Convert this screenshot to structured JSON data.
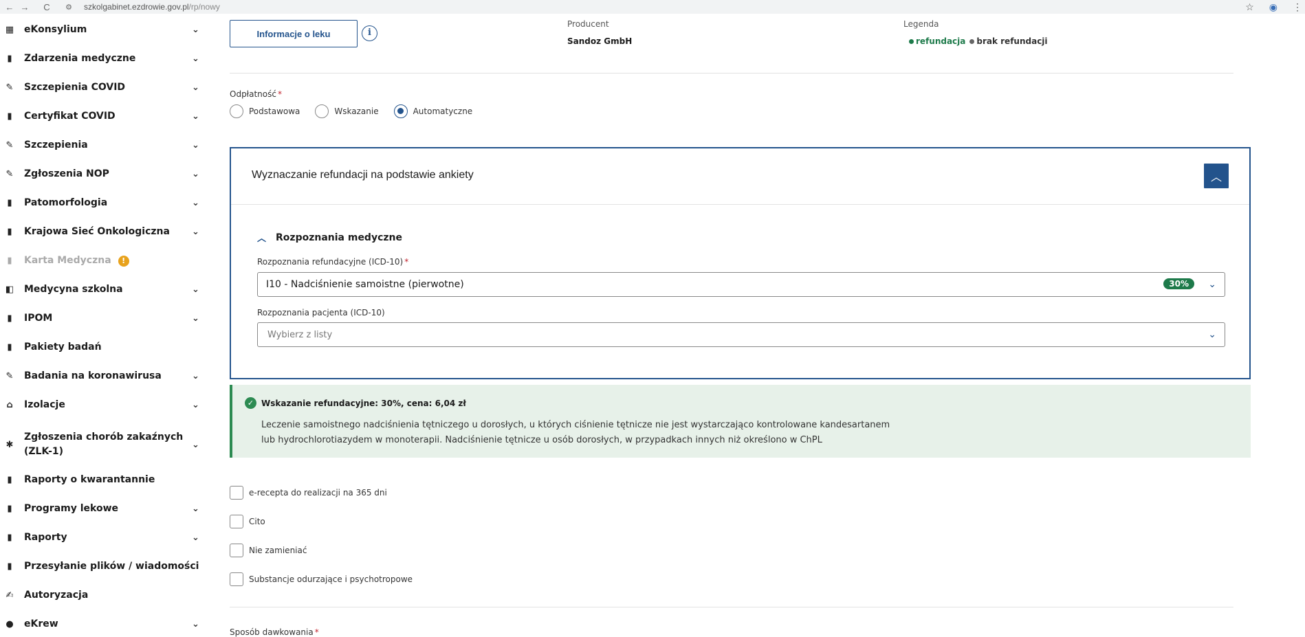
{
  "browser": {
    "back": "←",
    "forward": "→",
    "reload": "C",
    "site_icon": "⚙",
    "url_host": "szkolgabinet.ezdrowie.gov.pl",
    "url_path": "/rp/nowy",
    "star": "☆",
    "profile": "◉",
    "menu": "⋮"
  },
  "sidebar": {
    "items": [
      {
        "label": "eKonsylium",
        "icon": "▦",
        "chev": "⌄"
      },
      {
        "label": "Zdarzenia medyczne",
        "icon": "▮",
        "chev": "⌄"
      },
      {
        "label": "Szczepienia COVID",
        "icon": "✎",
        "chev": "⌄"
      },
      {
        "label": "Certyfikat COVID",
        "icon": "▮",
        "chev": "⌄"
      },
      {
        "label": "Szczepienia",
        "icon": "✎",
        "chev": "⌄"
      },
      {
        "label": "Zgłoszenia NOP",
        "icon": "✎",
        "chev": "⌄"
      },
      {
        "label": "Patomorfologia",
        "icon": "▮",
        "chev": "⌄"
      },
      {
        "label": "Krajowa Sieć Onkologiczna",
        "icon": "▮",
        "chev": "⌄"
      },
      {
        "label": "Karta Medyczna",
        "icon": "▮",
        "badge": "!"
      },
      {
        "label": "Medycyna szkolna",
        "icon": "◧",
        "chev": "⌄"
      },
      {
        "label": "IPOM",
        "icon": "▮",
        "chev": "⌄"
      },
      {
        "label": "Pakiety badań",
        "icon": "▮"
      },
      {
        "label": "Badania na koronawirusa",
        "icon": "✎",
        "chev": "⌄"
      },
      {
        "label": "Izolacje",
        "icon": "⌂",
        "chev": "⌄"
      },
      {
        "label": "Zgłoszenia chorób zakaźnych",
        "label2": "(ZLK-1)",
        "icon": "✱",
        "chev": "⌄"
      },
      {
        "label": "Raporty o kwarantannie",
        "icon": "▮"
      },
      {
        "label": "Programy lekowe",
        "icon": "▮",
        "chev": "⌄"
      },
      {
        "label": "Raporty",
        "icon": "▮",
        "chev": "⌄"
      },
      {
        "label": "Przesyłanie plików / wiadomości",
        "icon": "▮"
      },
      {
        "label": "Autoryzacja",
        "icon": "✍"
      },
      {
        "label": "eKrew",
        "icon": "●",
        "chev": "⌄"
      }
    ]
  },
  "main": {
    "info_button": "Informacje o leku",
    "info_icon": "i",
    "producent_label": "Producent",
    "producent_value": "Sandoz GmbH",
    "legenda_label": "Legenda",
    "legenda_refundacja": "refundacja",
    "legenda_brak": "brak refundacji",
    "odplatnosc_label": "Odpłatność",
    "required_mark": "*",
    "radios": [
      {
        "label": "Podstawowa",
        "checked": false
      },
      {
        "label": "Wskazanie",
        "checked": false
      },
      {
        "label": "Automatyczne",
        "checked": true
      }
    ],
    "panel": {
      "title": "Wyznaczanie refundacji na podstawie ankiety",
      "collapse_icon": "︿",
      "section_caret": "︿",
      "section_title": "Rozpoznania medyczne",
      "refund_label": "Rozpoznania refundacyjne (ICD-10)",
      "refund_value": "I10 - Nadciśnienie samoistne (pierwotne)",
      "refund_badge": "30%",
      "patient_label": "Rozpoznania pacjenta (ICD-10)",
      "patient_placeholder": "Wybierz z listy",
      "chev": "⌄"
    },
    "alert": {
      "icon": "✓",
      "title": "Wskazanie refundacyjne: 30%, cena: 6,04 zł",
      "line1": "Leczenie samoistnego nadciśnienia tętniczego u dorosłych, u których ciśnienie tętnicze nie jest wystarczająco kontrolowane kandesartanem",
      "line2": "lub hydrochlorotiazydem w monoterapii. Nadciśnienie tętnicze u osób dorosłych, w przypadkach innych niż określono w ChPL"
    },
    "checkboxes": [
      {
        "label": "e-recepta do realizacji na 365 dni"
      },
      {
        "label": "Cito"
      },
      {
        "label": "Nie zamieniać"
      },
      {
        "label": "Substancje odurzające i psychotropowe"
      }
    ],
    "sposob_label": "Sposób dawkowania"
  },
  "colors": {
    "primary": "#23538c",
    "success": "#1d7a4a",
    "alert_bg": "#e7f1e9",
    "required": "#c2242e",
    "warning": "#e8a21c"
  }
}
